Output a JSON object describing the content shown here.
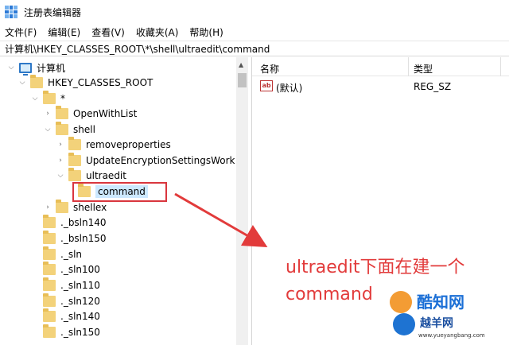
{
  "window": {
    "title": "注册表编辑器"
  },
  "menu": [
    {
      "label": "文件(F)"
    },
    {
      "label": "编辑(E)"
    },
    {
      "label": "查看(V)"
    },
    {
      "label": "收藏夹(A)"
    },
    {
      "label": "帮助(H)"
    }
  ],
  "address": {
    "path": "计算机\\HKEY_CLASSES_ROOT\\*\\shell\\ultraedit\\command"
  },
  "tree": {
    "root": "计算机",
    "hkcr": "HKEY_CLASSES_ROOT",
    "star": "*",
    "openwithlist": "OpenWithList",
    "shell": "shell",
    "removeproperties": "removeproperties",
    "updateencryption": "UpdateEncryptionSettingsWork",
    "ultraedit": "ultraedit",
    "command": "command",
    "shellex": "shellex",
    "bsln140": "._bsln140",
    "bsln150": "._bsln150",
    "sln": "._sln",
    "sln100": "._sln100",
    "sln110": "._sln110",
    "sln120": "._sln120",
    "sln140": "._sln140",
    "sln150": "._sln150"
  },
  "list": {
    "col_name": "名称",
    "col_type": "类型",
    "rows": [
      {
        "icon": "ab",
        "name": "(默认)",
        "type": "REG_SZ"
      }
    ]
  },
  "annotation": {
    "line1": "ultraedit下面在建一个",
    "line2": "command"
  },
  "watermark": {
    "logo": "酷知网",
    "brand": "越羊网",
    "url": "www.yueyangbang.com"
  },
  "colors": {
    "annotation": "#e23b3b",
    "selection": "#cce8ff",
    "folder": "#f3d27a"
  }
}
